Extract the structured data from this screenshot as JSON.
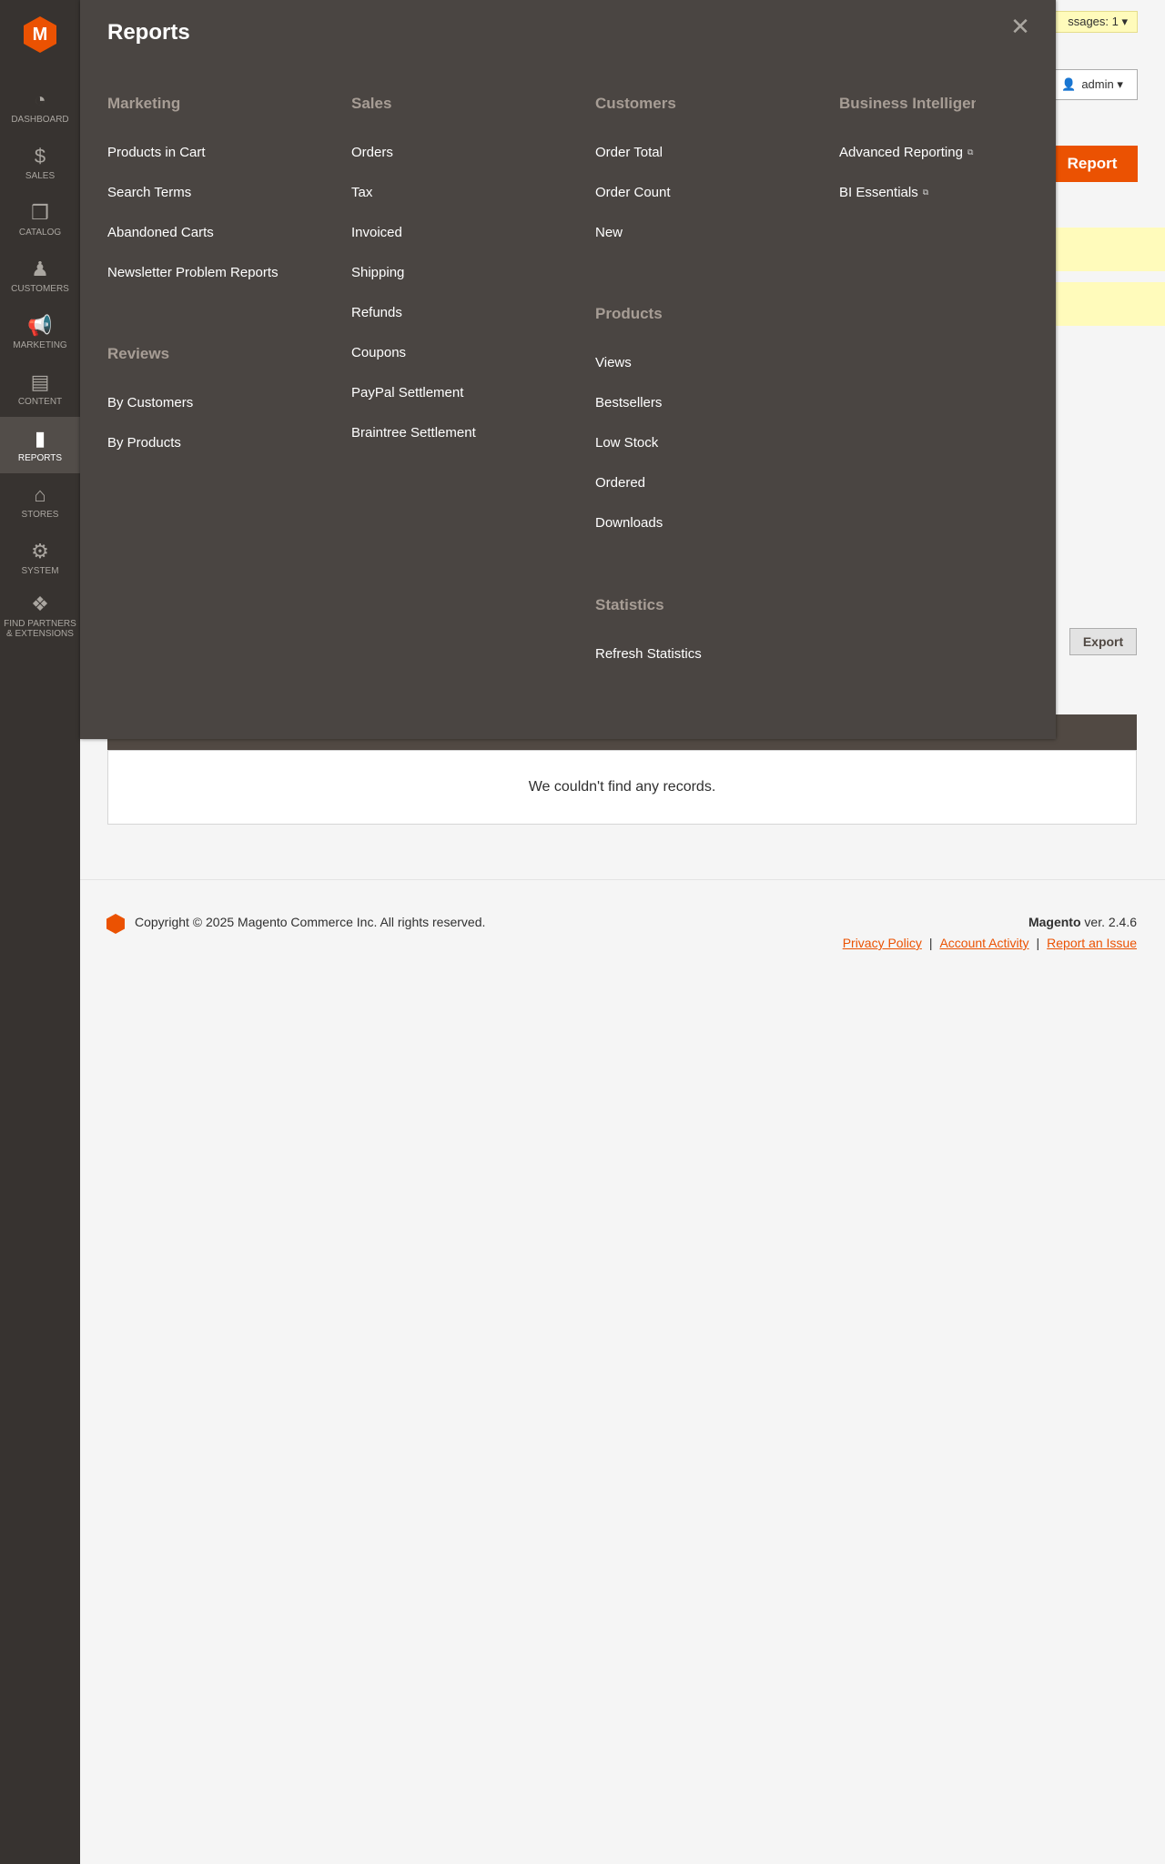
{
  "sidebar": {
    "logo": "M",
    "items": [
      {
        "label": "Dashboard",
        "icon": "dashboard-icon",
        "glyph": "◔"
      },
      {
        "label": "Sales",
        "icon": "dollar-icon",
        "glyph": "$"
      },
      {
        "label": "Catalog",
        "icon": "box-icon",
        "glyph": "❒"
      },
      {
        "label": "Customers",
        "icon": "person-icon",
        "glyph": "♟"
      },
      {
        "label": "Marketing",
        "icon": "megaphone-icon",
        "glyph": "📢"
      },
      {
        "label": "Content",
        "icon": "layout-icon",
        "glyph": "▤"
      },
      {
        "label": "Reports",
        "icon": "bar-chart-icon",
        "glyph": "▮"
      },
      {
        "label": "Stores",
        "icon": "store-icon",
        "glyph": "⌂"
      },
      {
        "label": "System",
        "icon": "gear-icon",
        "glyph": "⚙"
      },
      {
        "label": "Find Partners & Extensions",
        "icon": "cube-icon",
        "glyph": "❖"
      }
    ]
  },
  "header": {
    "messages": "ssages: 1 ▾",
    "admin": "admin ▾",
    "report_button": "Report"
  },
  "flyout": {
    "title": "Reports",
    "close": "✕",
    "groups": {
      "marketing": {
        "title": "Marketing",
        "items": [
          "Products in Cart",
          "Search Terms",
          "Abandoned Carts",
          "Newsletter Problem Reports"
        ]
      },
      "reviews": {
        "title": "Reviews",
        "items": [
          "By Customers",
          "By Products"
        ]
      },
      "sales": {
        "title": "Sales",
        "items": [
          "Orders",
          "Tax",
          "Invoiced",
          "Shipping",
          "Refunds",
          "Coupons",
          "PayPal Settlement",
          "Braintree Settlement"
        ]
      },
      "customers": {
        "title": "Customers",
        "items": [
          "Order Total",
          "Order Count",
          "New"
        ]
      },
      "products": {
        "title": "Products",
        "items": [
          "Views",
          "Bestsellers",
          "Low Stock",
          "Ordered",
          "Downloads"
        ]
      },
      "statistics": {
        "title": "Statistics",
        "items": [
          "Refresh Statistics"
        ]
      },
      "bi": {
        "title": "Business Intelligence",
        "items": [
          "Advanced Reporting",
          "BI Essentials"
        ],
        "external_glyph": "⧉"
      }
    }
  },
  "grid": {
    "empty_text": "We couldn't find any records."
  },
  "export_button": "Export",
  "footer": {
    "copyright": "Copyright © 2025 Magento Commerce Inc. All rights reserved.",
    "brand": "Magento",
    "version": " ver. 2.4.6",
    "links": [
      "Privacy Policy",
      "Account Activity",
      "Report an Issue"
    ],
    "separator": "|"
  },
  "colors": {
    "accent": "#eb5202",
    "sidebar": "#373330",
    "flyout": "#4a4542"
  }
}
